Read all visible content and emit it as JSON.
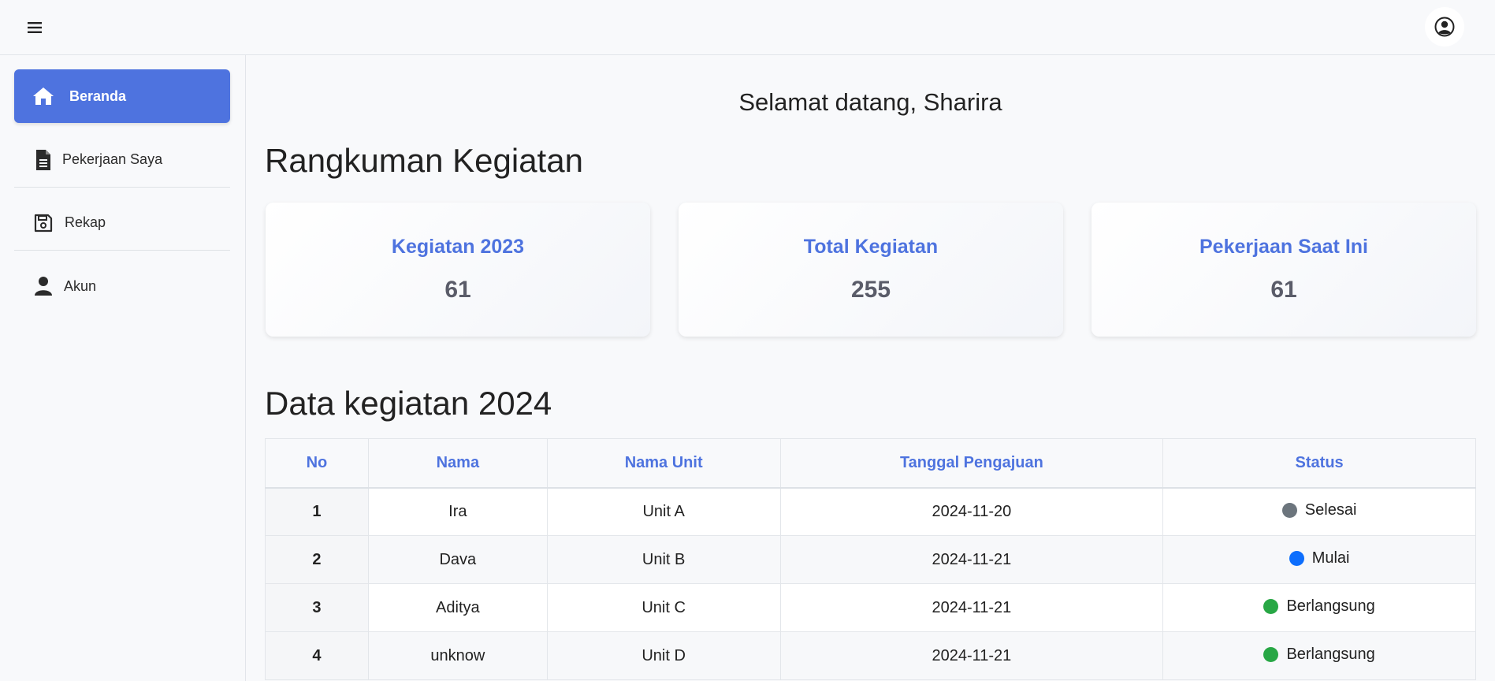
{
  "topbar": {
    "menu_icon": "hamburger-icon",
    "user_icon": "user-circle-icon"
  },
  "sidebar": {
    "items": [
      {
        "label": "Beranda",
        "icon": "home-icon",
        "active": true
      },
      {
        "label": "Pekerjaan Saya",
        "icon": "file-icon",
        "active": false
      },
      {
        "label": "Rekap",
        "icon": "save-icon",
        "active": false
      },
      {
        "label": "Akun",
        "icon": "user-icon",
        "active": false
      }
    ]
  },
  "welcome": "Selamat datang, Sharira",
  "summary": {
    "title": "Rangkuman Kegiatan",
    "cards": [
      {
        "title": "Kegiatan 2023",
        "value": "61"
      },
      {
        "title": "Total Kegiatan",
        "value": "255"
      },
      {
        "title": "Pekerjaan Saat Ini",
        "value": "61"
      }
    ]
  },
  "table_section": {
    "title": "Data kegiatan 2024",
    "columns": [
      "No",
      "Nama",
      "Nama Unit",
      "Tanggal Pengajuan",
      "Status"
    ],
    "rows": [
      {
        "no": "1",
        "nama": "Ira",
        "unit": "Unit A",
        "tanggal": "2024-11-20",
        "status": "Selesai",
        "status_color": "#6c757d"
      },
      {
        "no": "2",
        "nama": "Dava",
        "unit": "Unit B",
        "tanggal": "2024-11-21",
        "status": "Mulai",
        "status_color": "#0d6efd"
      },
      {
        "no": "3",
        "nama": "Aditya",
        "unit": "Unit C",
        "tanggal": "2024-11-21",
        "status": "Berlangsung",
        "status_color": "#28a745"
      },
      {
        "no": "4",
        "nama": "unknow",
        "unit": "Unit D",
        "tanggal": "2024-11-21",
        "status": "Berlangsung",
        "status_color": "#28a745"
      }
    ]
  },
  "colors": {
    "accent": "#4e73df",
    "background": "#f8f9fb"
  }
}
